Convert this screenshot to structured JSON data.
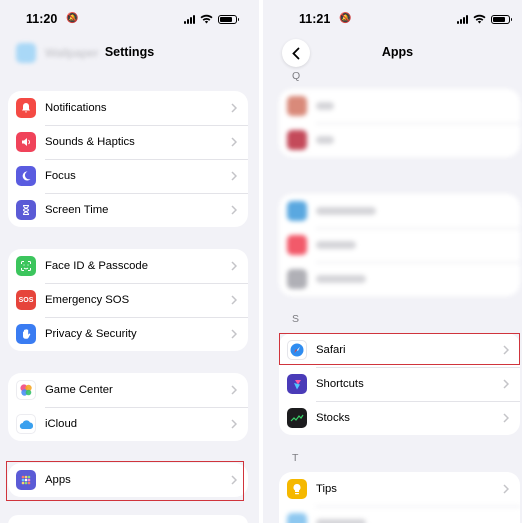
{
  "left": {
    "status": {
      "time": "11:20"
    },
    "title": "Settings",
    "ghost_top": [
      "Wallpaper"
    ],
    "groups": [
      [
        {
          "label": "Notifications",
          "icon": "bell-icon",
          "color": "#f44a44"
        },
        {
          "label": "Sounds & Haptics",
          "icon": "speaker-icon",
          "color": "#f0435a"
        },
        {
          "label": "Focus",
          "icon": "moon-icon",
          "color": "#5a5ce0"
        },
        {
          "label": "Screen Time",
          "icon": "hourglass-icon",
          "color": "#5b5bd6"
        }
      ],
      [
        {
          "label": "Face ID & Passcode",
          "icon": "faceid-icon",
          "color": "#3cc55d"
        },
        {
          "label": "Emergency SOS",
          "icon": "sos-icon",
          "color": "#e6443b",
          "glyph": "SOS"
        },
        {
          "label": "Privacy & Security",
          "icon": "hand-icon",
          "color": "#3a7cf2"
        }
      ],
      [
        {
          "label": "Game Center",
          "icon": "game-center-icon",
          "color": "#ffffff"
        },
        {
          "label": "iCloud",
          "icon": "cloud-icon",
          "color": "#ffffff"
        }
      ],
      [
        {
          "label": "Apps",
          "icon": "apps-grid-icon",
          "color": "#5b5bd6"
        }
      ]
    ]
  },
  "right": {
    "status": {
      "time": "11:21"
    },
    "title": "Apps",
    "sections": [
      "Q",
      "S",
      "T"
    ],
    "s_items": [
      {
        "label": "Safari",
        "icon": "safari-icon",
        "color": "#ffffff"
      },
      {
        "label": "Shortcuts",
        "icon": "shortcuts-icon",
        "color": "#4a3bb8"
      },
      {
        "label": "Stocks",
        "icon": "stocks-icon",
        "color": "#1c1c1e"
      }
    ],
    "t_items": [
      {
        "label": "Tips",
        "icon": "lightbulb-icon",
        "color": "#f5b800"
      }
    ]
  }
}
